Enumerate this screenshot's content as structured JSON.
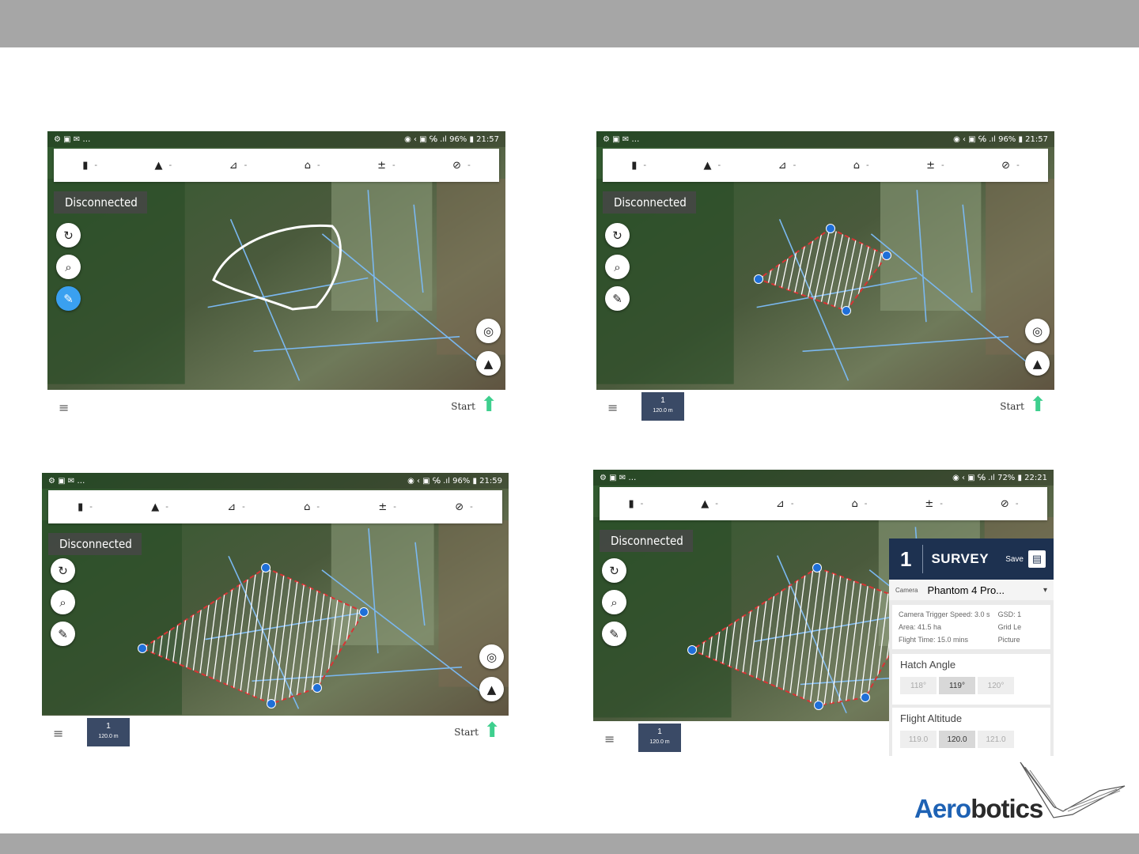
{
  "colors": {
    "header_band": "#a6a6a6",
    "panel_header": "#1d3150",
    "grid_line": "#d93333",
    "waypoint": "#1f6fd8",
    "field_boundary": "#7ab8f0",
    "start_icon": "#3ecf8e",
    "logo_blue": "#1e62b4"
  },
  "screens": [
    {
      "status_right": "◉ ‹ ▣ ℅ .ıl 96% ▮ 21:57",
      "telemetry": [
        "-",
        "-",
        "-",
        "-",
        "-",
        "-"
      ],
      "connection": "Disconnected",
      "start_label": "Start",
      "menu_icon": "menu-icon",
      "fabs": [
        "sync-icon",
        "search-icon",
        "pencil-icon"
      ],
      "has_waypoint_badge": false
    },
    {
      "status_right": "◉ ‹ ▣ ℅ .ıl 96% ▮ 21:57",
      "telemetry": [
        "-",
        "-",
        "-",
        "-",
        "-",
        "-"
      ],
      "connection": "Disconnected",
      "start_label": "Start",
      "waypoint": {
        "index": "1",
        "altitude": "120.0 m"
      }
    },
    {
      "status_right": "◉ ‹ ▣ ℅ .ıl 96% ▮ 21:59",
      "telemetry": [
        "-",
        "-",
        "-",
        "-",
        "-",
        "-"
      ],
      "connection": "Disconnected",
      "start_label": "Start",
      "waypoint": {
        "index": "1",
        "altitude": "120.0 m"
      }
    },
    {
      "status_right": "◉ ‹ ▣ ℅ .ıl 72% ▮ 22:21",
      "telemetry": [
        "-",
        "-",
        "-",
        "-",
        "-",
        "-"
      ],
      "connection": "Disconnected",
      "waypoint": {
        "index": "1",
        "altitude": "120.0 m"
      },
      "survey_panel": {
        "number": "1",
        "title": "SURVEY",
        "save": "Save",
        "camera_label": "Camera",
        "camera_value": "Phantom 4 Pro...",
        "stats_left": [
          "Camera Trigger Speed: 3.0 s",
          "Area: 41.5 ha",
          "Flight Time: 15.0 mins"
        ],
        "stats_right": [
          "GSD: 1",
          "Grid Le",
          "Picture"
        ],
        "hatch_title": "Hatch Angle",
        "hatch_opts": [
          "118°",
          "119°",
          "120°"
        ],
        "alt_title": "Flight Altitude",
        "alt_opts": [
          "119.0",
          "120.0",
          "121.0"
        ]
      }
    }
  ],
  "logo": {
    "prefix": "Aero",
    "suffix": "botics"
  }
}
